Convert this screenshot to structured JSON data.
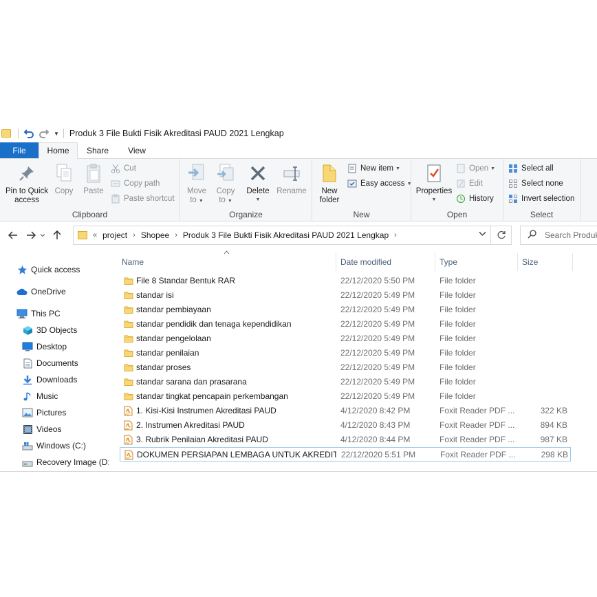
{
  "window": {
    "title": "Produk 3 File Bukti Fisik Akreditasi PAUD 2021 Lengkap"
  },
  "tabs": [
    {
      "label": "File"
    },
    {
      "label": "Home"
    },
    {
      "label": "Share"
    },
    {
      "label": "View"
    }
  ],
  "ribbon": {
    "clipboard": {
      "label": "Clipboard",
      "pin": "Pin to Quick",
      "pin2": "access",
      "copy": "Copy",
      "paste": "Paste",
      "cut": "Cut",
      "copy_path": "Copy path",
      "paste_shortcut": "Paste shortcut"
    },
    "organize": {
      "label": "Organize",
      "move": "Move",
      "move2": "to",
      "copy": "Copy",
      "copy2": "to",
      "delete": "Delete",
      "rename": "Rename"
    },
    "new": {
      "label": "New",
      "new_folder": "New",
      "new_folder2": "folder",
      "new_item": "New item",
      "easy_access": "Easy access"
    },
    "open": {
      "label": "Open",
      "properties": "Properties",
      "open": "Open",
      "edit": "Edit",
      "history": "History"
    },
    "select": {
      "label": "Select",
      "select_all": "Select all",
      "select_none": "Select none",
      "invert": "Invert selection"
    }
  },
  "address": {
    "prefix": "«",
    "crumbs": [
      "project",
      "Shopee",
      "Produk 3 File Bukti Fisik Akreditasi PAUD 2021 Lengkap"
    ],
    "search_placeholder": "Search Produk"
  },
  "sidebar": {
    "items": [
      {
        "label": "Quick access",
        "icon": "star-icon"
      },
      {
        "label": "OneDrive",
        "icon": "cloud-icon"
      },
      {
        "label": "This PC",
        "icon": "computer-icon"
      },
      {
        "label": "3D Objects",
        "icon": "cube-icon"
      },
      {
        "label": "Desktop",
        "icon": "desktop-icon"
      },
      {
        "label": "Documents",
        "icon": "document-icon"
      },
      {
        "label": "Downloads",
        "icon": "download-icon"
      },
      {
        "label": "Music",
        "icon": "music-icon"
      },
      {
        "label": "Pictures",
        "icon": "pictures-icon"
      },
      {
        "label": "Videos",
        "icon": "video-icon"
      },
      {
        "label": "Windows (C:)",
        "icon": "drive-icon"
      },
      {
        "label": "Recovery Image (D:)",
        "icon": "drive-icon"
      }
    ]
  },
  "columns": {
    "name": "Name",
    "date": "Date modified",
    "type": "Type",
    "size": "Size"
  },
  "files": [
    {
      "name": "File 8 Standar Bentuk RAR",
      "date": "22/12/2020 5:50 PM",
      "type": "File folder",
      "size": "",
      "kind": "folder"
    },
    {
      "name": "standar isi",
      "date": "22/12/2020 5:49 PM",
      "type": "File folder",
      "size": "",
      "kind": "folder"
    },
    {
      "name": "standar pembiayaan",
      "date": "22/12/2020 5:49 PM",
      "type": "File folder",
      "size": "",
      "kind": "folder"
    },
    {
      "name": "standar pendidik dan tenaga kependidikan",
      "date": "22/12/2020 5:49 PM",
      "type": "File folder",
      "size": "",
      "kind": "folder"
    },
    {
      "name": "standar pengelolaan",
      "date": "22/12/2020 5:49 PM",
      "type": "File folder",
      "size": "",
      "kind": "folder"
    },
    {
      "name": "standar penilaian",
      "date": "22/12/2020 5:49 PM",
      "type": "File folder",
      "size": "",
      "kind": "folder"
    },
    {
      "name": "standar proses",
      "date": "22/12/2020 5:49 PM",
      "type": "File folder",
      "size": "",
      "kind": "folder"
    },
    {
      "name": "standar sarana dan prasarana",
      "date": "22/12/2020 5:49 PM",
      "type": "File folder",
      "size": "",
      "kind": "folder"
    },
    {
      "name": "standar tingkat pencapain perkembangan",
      "date": "22/12/2020 5:49 PM",
      "type": "File folder",
      "size": "",
      "kind": "folder"
    },
    {
      "name": "1. Kisi-Kisi Instrumen Akreditasi PAUD",
      "date": "4/12/2020 8:42 PM",
      "type": "Foxit Reader PDF ...",
      "size": "322 KB",
      "kind": "pdf"
    },
    {
      "name": "2. Instrumen Akreditasi PAUD",
      "date": "4/12/2020 8:43 PM",
      "type": "Foxit Reader PDF ...",
      "size": "894 KB",
      "kind": "pdf"
    },
    {
      "name": "3. Rubrik Penilaian Akreditasi PAUD",
      "date": "4/12/2020 8:44 PM",
      "type": "Foxit Reader PDF ...",
      "size": "987 KB",
      "kind": "pdf"
    },
    {
      "name": "DOKUMEN PERSIAPAN LEMBAGA UNTUK AKREDITASI",
      "date": "22/12/2020 5:51 PM",
      "type": "Foxit Reader PDF ...",
      "size": "298 KB",
      "kind": "pdf",
      "selected": true
    }
  ],
  "colors": {
    "file_tab": "#1a6fc9",
    "folder": "#f8d775",
    "selection_border": "#99c9ef"
  }
}
